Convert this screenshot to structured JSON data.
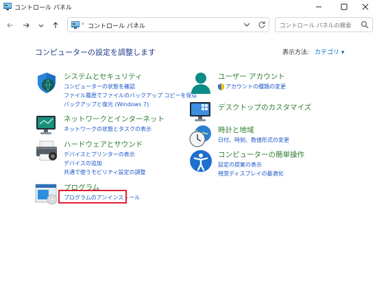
{
  "window": {
    "title": "コントロール パネル",
    "minimize_icon": "minimize-icon",
    "maximize_icon": "maximize-icon",
    "close_icon": "close-icon"
  },
  "nav": {
    "back_icon": "back-arrow-icon",
    "forward_icon": "forward-arrow-icon",
    "recent_icon": "chevron-down-icon",
    "up_icon": "up-arrow-icon"
  },
  "address": {
    "separator": "›",
    "crumb": "コントロール パネル",
    "trailing": "›"
  },
  "search": {
    "placeholder": "コントロール パネルの検索"
  },
  "page": {
    "heading": "コンピューターの設定を調整します",
    "view_by_label": "表示方法:",
    "view_by_value": "カテゴリ ▾"
  },
  "categories_left": [
    {
      "title": "システムとセキュリティ",
      "links": [
        "コンピューターの状態を確認",
        "ファイル履歴でファイルのバックアップ コピーを保存",
        "バックアップと復元 (Windows 7)"
      ]
    },
    {
      "title": "ネットワークとインターネット",
      "links": [
        "ネットワークの状態とタスクの表示"
      ]
    },
    {
      "title": "ハードウェアとサウンド",
      "links": [
        "デバイスとプリンターの表示",
        "デバイスの追加",
        "共通で使うモビリティ設定の調整"
      ]
    },
    {
      "title": "プログラム",
      "links": [
        "プログラムのアンインストール"
      ]
    }
  ],
  "categories_right": [
    {
      "title": "ユーザー アカウント",
      "links": [
        "アカウントの種類の変更"
      ]
    },
    {
      "title": "デスクトップのカスタマイズ",
      "links": []
    },
    {
      "title": "時計と地域",
      "links": [
        "日付、時刻、数値形式の変更"
      ]
    },
    {
      "title": "コンピューターの簡単操作",
      "links": [
        "設定の提案の表示",
        "視覚ディスプレイの最適化"
      ]
    }
  ],
  "colors": {
    "accent": "#1a56c8",
    "category_title": "#2e7d32",
    "heading": "#1e3a8a",
    "highlight": "#e11d2e"
  }
}
